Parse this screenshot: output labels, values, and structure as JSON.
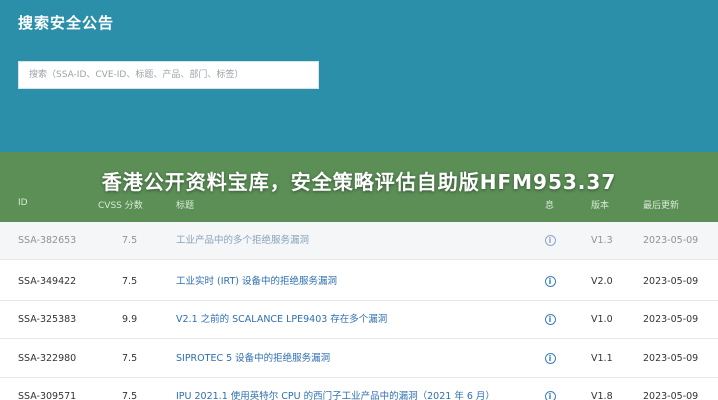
{
  "header": {
    "title": "搜索安全公告",
    "search_placeholder": "搜索（SSA-ID、CVE-ID、标题、产品、部门、标签）"
  },
  "overlay_title": "香港公开资料宝库，安全策略评估自助版HFM953.37",
  "columns": {
    "id": "ID",
    "cvss": "CVSS 分数",
    "title": "标题",
    "icon": "息",
    "version": "版本",
    "date": "最后更新"
  },
  "rows": [
    {
      "id": "SSA-382653",
      "cvss": "7.5",
      "title": "工业产品中的多个拒绝服务漏洞",
      "version": "V1.3",
      "date": "2023-05-09"
    },
    {
      "id": "SSA-349422",
      "cvss": "7.5",
      "title": "工业实时 (IRT) 设备中的拒绝服务漏洞",
      "version": "V2.0",
      "date": "2023-05-09"
    },
    {
      "id": "SSA-325383",
      "cvss": "9.9",
      "title": "V2.1 之前的 SCALANCE LPE9403 存在多个漏洞",
      "version": "V1.0",
      "date": "2023-05-09"
    },
    {
      "id": "SSA-322980",
      "cvss": "7.5",
      "title": "SIPROTEC 5 设备中的拒绝服务漏洞",
      "version": "V1.1",
      "date": "2023-05-09"
    },
    {
      "id": "SSA-309571",
      "cvss": "7.5",
      "title": "IPU 2021.1 使用英特尔 CPU 的西门子工业产品中的漏洞（2021 年 6 月）",
      "version": "V1.8",
      "date": "2023-05-09"
    }
  ]
}
